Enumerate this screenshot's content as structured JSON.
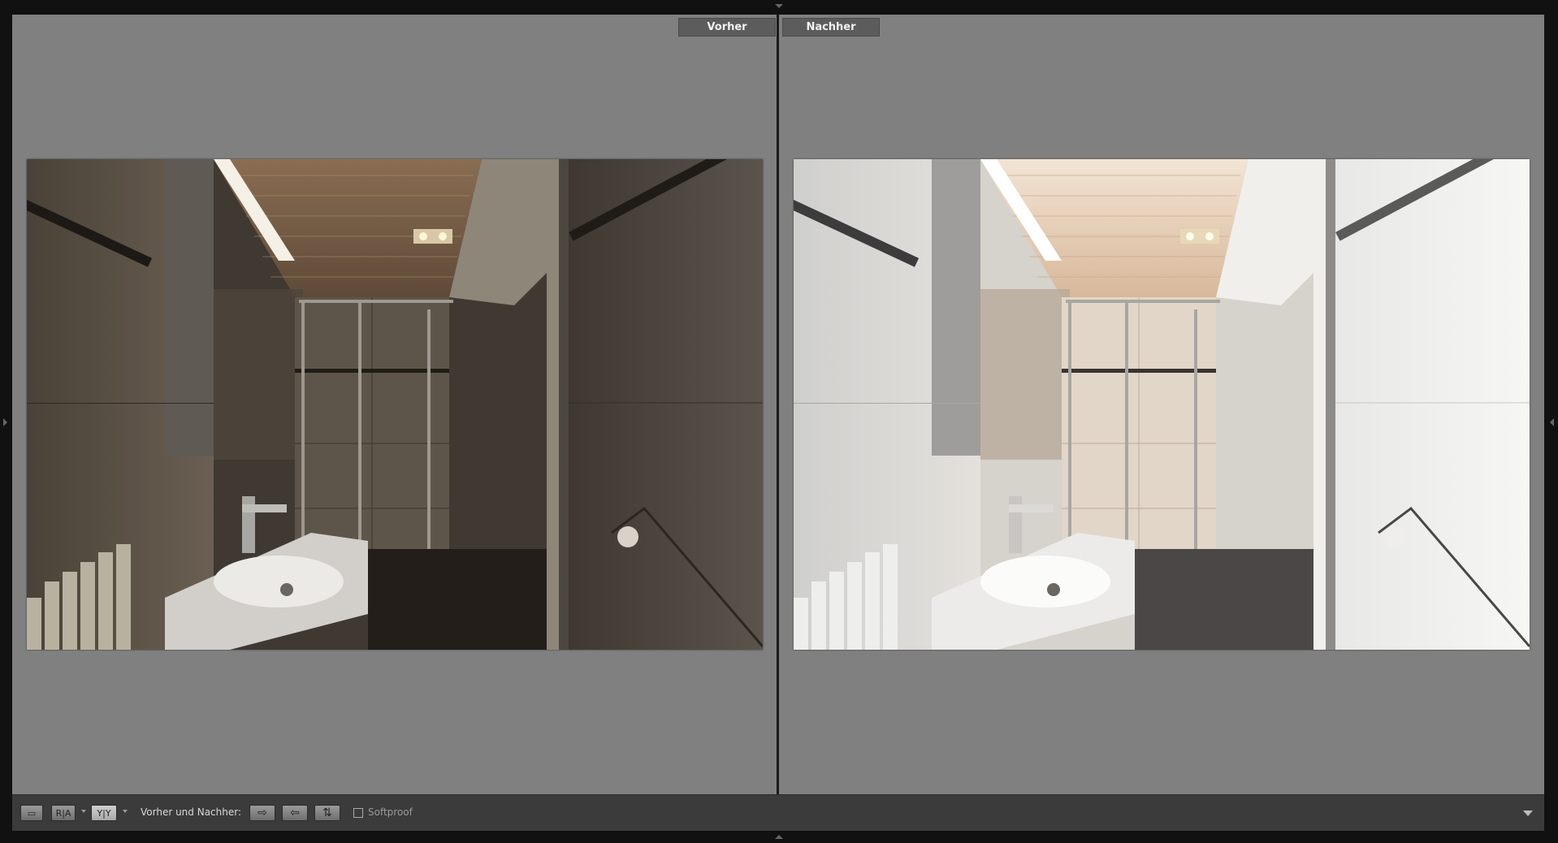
{
  "labels": {
    "before": "Vorher",
    "after": "Nachher"
  },
  "toolbar": {
    "view_loupe": "▭",
    "view_ba_left_right": "R|A",
    "view_ba_top_bottom": "Y|Y",
    "compare_label": "Vorher und Nachher:",
    "copy_before_to_after": "⇨",
    "copy_after_to_before": "⇦",
    "swap": "⇅",
    "softproof_label": "Softproof"
  },
  "colors": {
    "panel_bg": "#808080",
    "toolbar_bg": "#3b3b3b",
    "tab_bg": "#5c5c5c"
  }
}
